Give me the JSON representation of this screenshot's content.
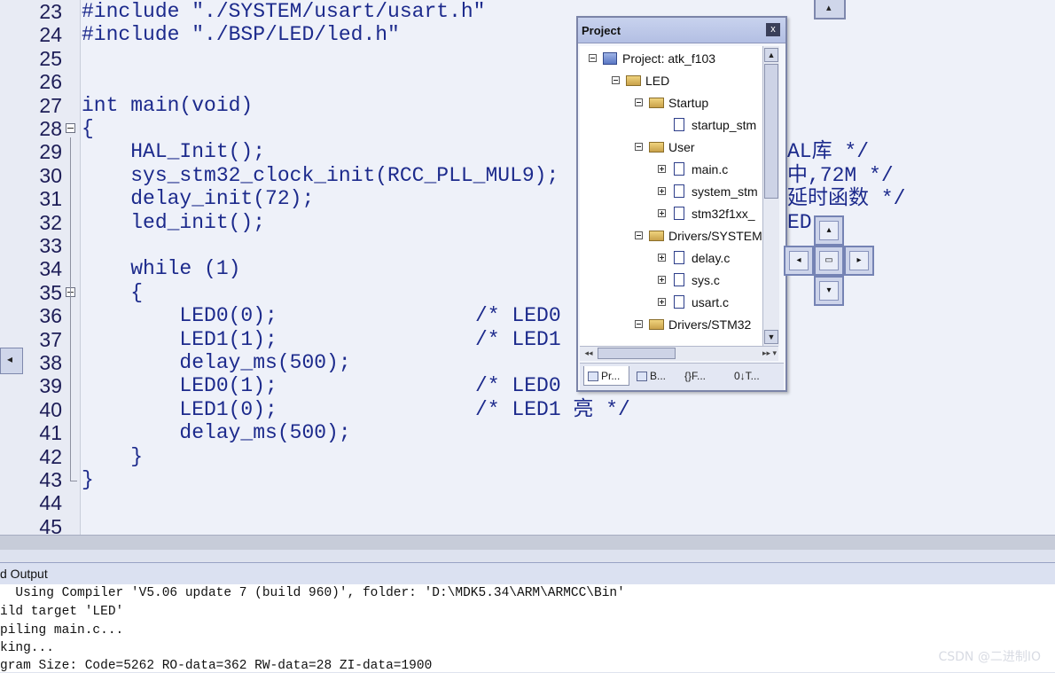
{
  "editor": {
    "lines": [
      {
        "num": "23",
        "code": "#include \"./SYSTEM/usart/usart.h\"",
        "comment": ""
      },
      {
        "num": "24",
        "code": "#include \"./BSP/LED/led.h\"",
        "comment": ""
      },
      {
        "num": "25",
        "code": "",
        "comment": ""
      },
      {
        "num": "26",
        "code": "",
        "comment": ""
      },
      {
        "num": "27",
        "code": "int main(void)",
        "comment": ""
      },
      {
        "num": "28",
        "code": "{",
        "comment": ""
      },
      {
        "num": "29",
        "code": "    HAL_Init();",
        "comment": "AL库 */"
      },
      {
        "num": "30",
        "code": "    sys_stm32_clock_init(RCC_PLL_MUL9);",
        "comment": "中,72M */"
      },
      {
        "num": "31",
        "code": "    delay_init(72);",
        "comment": "延时函数 */"
      },
      {
        "num": "32",
        "code": "    led_init();",
        "comment": "ED"
      },
      {
        "num": "33",
        "code": "",
        "comment": ""
      },
      {
        "num": "34",
        "code": "    while (1)",
        "comment": ""
      },
      {
        "num": "35",
        "code": "    {",
        "comment": ""
      },
      {
        "num": "36",
        "code": "        LED0(0);",
        "comment": "/* LED0"
      },
      {
        "num": "37",
        "code": "        LED1(1);",
        "comment": "/* LED1"
      },
      {
        "num": "38",
        "code": "        delay_ms(500);",
        "comment": ""
      },
      {
        "num": "39",
        "code": "        LED0(1);",
        "comment": "/* LED0"
      },
      {
        "num": "40",
        "code": "        LED1(0);",
        "comment": "/* LED1 亮 */"
      },
      {
        "num": "41",
        "code": "        delay_ms(500);",
        "comment": ""
      },
      {
        "num": "42",
        "code": "    }",
        "comment": ""
      },
      {
        "num": "43",
        "code": "}",
        "comment": ""
      },
      {
        "num": "44",
        "code": "",
        "comment": ""
      },
      {
        "num": "45",
        "code": "",
        "comment": ""
      }
    ]
  },
  "project": {
    "title": "Project",
    "close": "x",
    "tree": [
      {
        "label": "Project: atk_f103",
        "icon": "project-icon"
      },
      {
        "label": "LED",
        "icon": "target-icon"
      },
      {
        "label": "Startup",
        "icon": "folder-icon"
      },
      {
        "label": "startup_stm",
        "icon": "file-icon"
      },
      {
        "label": "User",
        "icon": "folder-icon"
      },
      {
        "label": "main.c",
        "icon": "file-icon"
      },
      {
        "label": "system_stm",
        "icon": "file-icon"
      },
      {
        "label": "stm32f1xx_",
        "icon": "file-icon"
      },
      {
        "label": "Drivers/SYSTEM",
        "icon": "folder-icon"
      },
      {
        "label": "delay.c",
        "icon": "file-icon"
      },
      {
        "label": "sys.c",
        "icon": "file-icon"
      },
      {
        "label": "usart.c",
        "icon": "file-icon"
      },
      {
        "label": "Drivers/STM32",
        "icon": "folder-icon"
      }
    ],
    "tabs": [
      {
        "label": "Pr..."
      },
      {
        "label": "B..."
      },
      {
        "label": "{}F..."
      },
      {
        "label": "0↓T..."
      }
    ]
  },
  "output": {
    "title": "d Output",
    "lines": [
      "  Using Compiler 'V5.06 update 7 (build 960)', folder: 'D:\\MDK5.34\\ARM\\ARMCC\\Bin'",
      "ild target 'LED'",
      "piling main.c...",
      "king...",
      "gram Size: Code=5262 RO-data=362 RW-data=28 ZI-data=1900"
    ]
  },
  "watermark": "CSDN @二进制IO"
}
